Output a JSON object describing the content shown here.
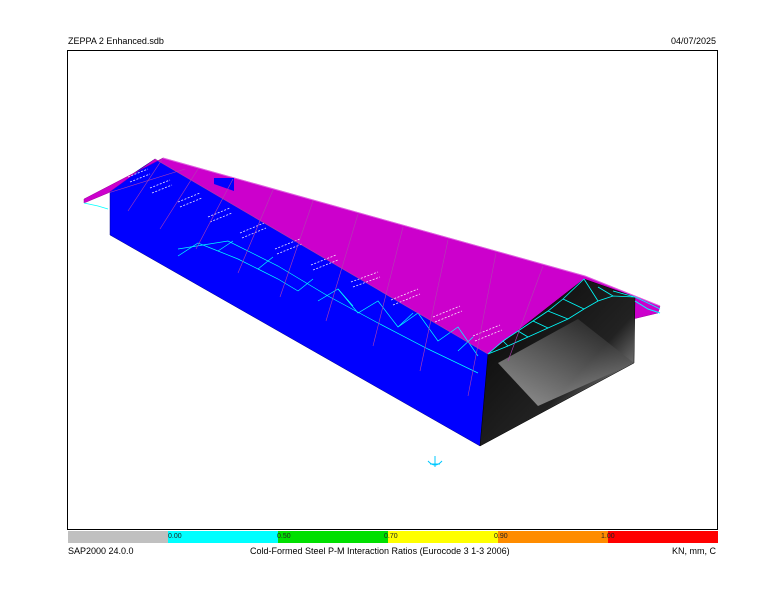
{
  "header": {
    "file_name": "ZEPPA 2 Enhanced.sdb",
    "date": "04/07/2025"
  },
  "footer": {
    "version": "SAP2000 24.0.0",
    "plot_title": "Cold-Formed Steel P-M Interaction Ratios  (Eurocode 3 1-3 2006)",
    "units": "KN, mm, C"
  },
  "legend": {
    "ticks": [
      "0.00",
      "0.50",
      "0.70",
      "0.90",
      "1.00"
    ],
    "colors": [
      "#c0c0c0",
      "#00ffff",
      "#00e000",
      "#ffff00",
      "#ff8c00",
      "#ff0000"
    ]
  },
  "model": {
    "wall_color": "#0000ff",
    "roof_color": "#cc00cc",
    "truss_color": "#00ffff"
  }
}
